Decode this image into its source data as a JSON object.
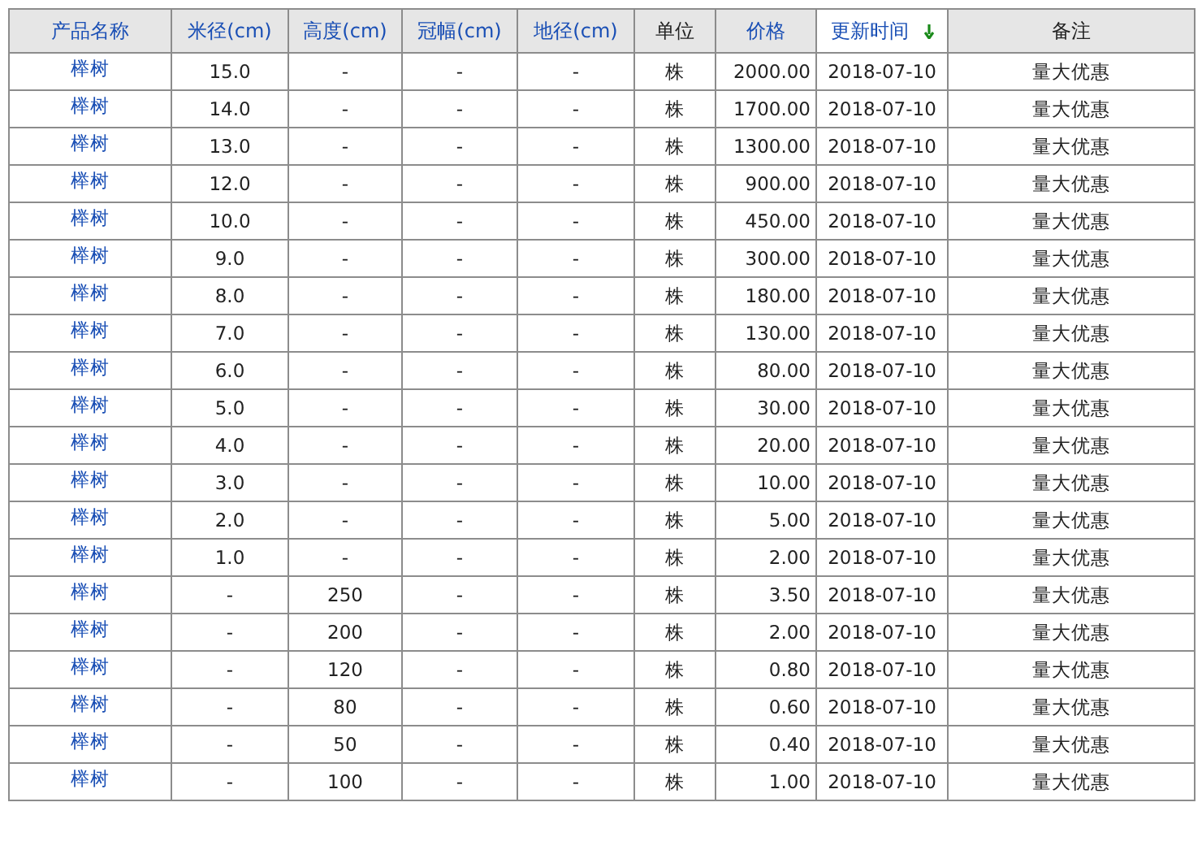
{
  "table": {
    "columns": [
      {
        "label": "产品名称",
        "sortable": true,
        "sorted": false
      },
      {
        "label": "米径(cm)",
        "sortable": true,
        "sorted": false
      },
      {
        "label": "高度(cm)",
        "sortable": true,
        "sorted": false
      },
      {
        "label": "冠幅(cm)",
        "sortable": true,
        "sorted": false
      },
      {
        "label": "地径(cm)",
        "sortable": true,
        "sorted": false
      },
      {
        "label": "单位",
        "sortable": false,
        "sorted": false
      },
      {
        "label": "价格",
        "sortable": true,
        "sorted": false
      },
      {
        "label": "更新时间",
        "sortable": true,
        "sorted": true
      },
      {
        "label": "备注",
        "sortable": false,
        "sorted": false
      }
    ],
    "rows": [
      [
        "榉树",
        "15.0",
        "-",
        "-",
        "-",
        "株",
        "2000.00",
        "2018-07-10",
        "量大优惠"
      ],
      [
        "榉树",
        "14.0",
        "-",
        "-",
        "-",
        "株",
        "1700.00",
        "2018-07-10",
        "量大优惠"
      ],
      [
        "榉树",
        "13.0",
        "-",
        "-",
        "-",
        "株",
        "1300.00",
        "2018-07-10",
        "量大优惠"
      ],
      [
        "榉树",
        "12.0",
        "-",
        "-",
        "-",
        "株",
        "900.00",
        "2018-07-10",
        "量大优惠"
      ],
      [
        "榉树",
        "10.0",
        "-",
        "-",
        "-",
        "株",
        "450.00",
        "2018-07-10",
        "量大优惠"
      ],
      [
        "榉树",
        "9.0",
        "-",
        "-",
        "-",
        "株",
        "300.00",
        "2018-07-10",
        "量大优惠"
      ],
      [
        "榉树",
        "8.0",
        "-",
        "-",
        "-",
        "株",
        "180.00",
        "2018-07-10",
        "量大优惠"
      ],
      [
        "榉树",
        "7.0",
        "-",
        "-",
        "-",
        "株",
        "130.00",
        "2018-07-10",
        "量大优惠"
      ],
      [
        "榉树",
        "6.0",
        "-",
        "-",
        "-",
        "株",
        "80.00",
        "2018-07-10",
        "量大优惠"
      ],
      [
        "榉树",
        "5.0",
        "-",
        "-",
        "-",
        "株",
        "30.00",
        "2018-07-10",
        "量大优惠"
      ],
      [
        "榉树",
        "4.0",
        "-",
        "-",
        "-",
        "株",
        "20.00",
        "2018-07-10",
        "量大优惠"
      ],
      [
        "榉树",
        "3.0",
        "-",
        "-",
        "-",
        "株",
        "10.00",
        "2018-07-10",
        "量大优惠"
      ],
      [
        "榉树",
        "2.0",
        "-",
        "-",
        "-",
        "株",
        "5.00",
        "2018-07-10",
        "量大优惠"
      ],
      [
        "榉树",
        "1.0",
        "-",
        "-",
        "-",
        "株",
        "2.00",
        "2018-07-10",
        "量大优惠"
      ],
      [
        "榉树",
        "-",
        "250",
        "-",
        "-",
        "株",
        "3.50",
        "2018-07-10",
        "量大优惠"
      ],
      [
        "榉树",
        "-",
        "200",
        "-",
        "-",
        "株",
        "2.00",
        "2018-07-10",
        "量大优惠"
      ],
      [
        "榉树",
        "-",
        "120",
        "-",
        "-",
        "株",
        "0.80",
        "2018-07-10",
        "量大优惠"
      ],
      [
        "榉树",
        "-",
        "80",
        "-",
        "-",
        "株",
        "0.60",
        "2018-07-10",
        "量大优惠"
      ],
      [
        "榉树",
        "-",
        "50",
        "-",
        "-",
        "株",
        "0.40",
        "2018-07-10",
        "量大优惠"
      ],
      [
        "榉树",
        "-",
        "100",
        "-",
        "-",
        "株",
        "1.00",
        "2018-07-10",
        "量大优惠"
      ]
    ]
  }
}
